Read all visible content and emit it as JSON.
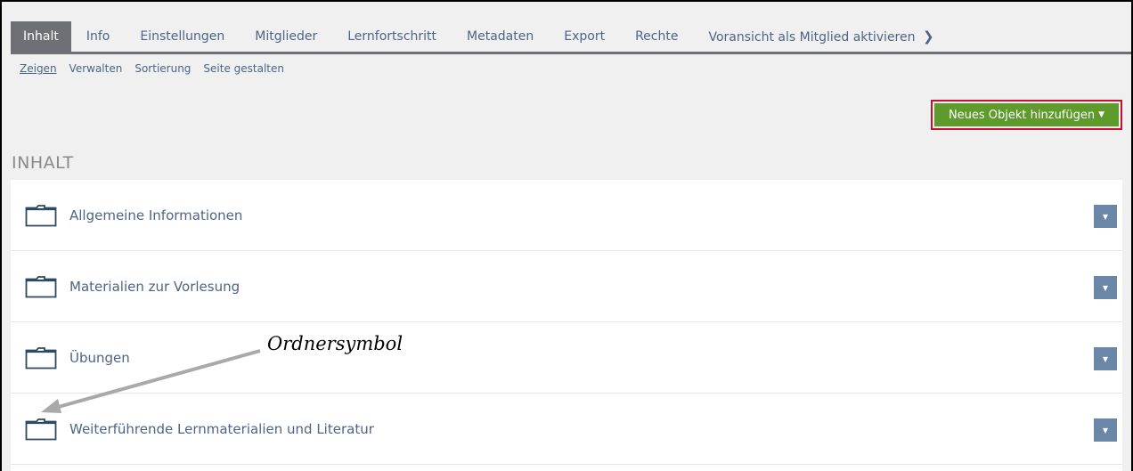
{
  "tabs": [
    {
      "label": "Inhalt",
      "active": true
    },
    {
      "label": "Info"
    },
    {
      "label": "Einstellungen"
    },
    {
      "label": "Mitglieder"
    },
    {
      "label": "Lernfortschritt"
    },
    {
      "label": "Metadaten"
    },
    {
      "label": "Export"
    },
    {
      "label": "Rechte"
    },
    {
      "label": "Voransicht als Mitglied aktivieren"
    }
  ],
  "subtabs": [
    {
      "label": "Zeigen",
      "active": true
    },
    {
      "label": "Verwalten"
    },
    {
      "label": "Sortierung"
    },
    {
      "label": "Seite gestalten"
    }
  ],
  "toolbar": {
    "add_label": "Neues Objekt hinzufügen"
  },
  "section": {
    "heading": "INHALT"
  },
  "items": [
    {
      "label": "Allgemeine Informationen",
      "icon": "folder-icon"
    },
    {
      "label": "Materialien zur Vorlesung",
      "icon": "folder-icon"
    },
    {
      "label": "Übungen",
      "icon": "folder-icon"
    },
    {
      "label": "Weiterführende Lernmaterialien und Literatur",
      "icon": "folder-icon"
    }
  ],
  "annotation": {
    "label": "Ordnersymbol"
  },
  "colors": {
    "accent_green": "#5e9b2c",
    "highlight_red": "#c8102e",
    "link_blue": "#4c6586",
    "action_blue": "#6a87a8"
  }
}
